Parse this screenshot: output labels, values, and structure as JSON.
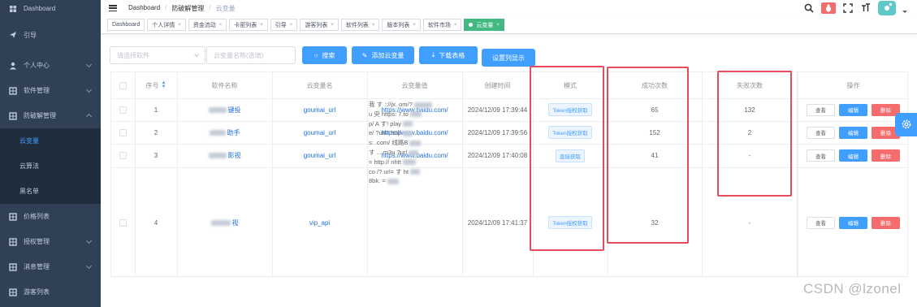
{
  "sidebar": {
    "items": [
      {
        "label": "Dashboard"
      },
      {
        "label": "引导"
      },
      {
        "label": "个人中心"
      },
      {
        "label": "软件管理"
      },
      {
        "label": "防破解管理"
      },
      {
        "label": "价格列表"
      },
      {
        "label": "授权管理"
      },
      {
        "label": "消息管理"
      },
      {
        "label": "游客列表"
      }
    ],
    "subitems": [
      {
        "label": "云变量"
      },
      {
        "label": "云算法"
      },
      {
        "label": "黑名单"
      }
    ]
  },
  "breadcrumb": {
    "items": [
      "Dashboard",
      "防破解管理",
      "云变量"
    ]
  },
  "tags": [
    {
      "label": "Dashboard"
    },
    {
      "label": "个人详情"
    },
    {
      "label": "资金流动"
    },
    {
      "label": "卡密列表"
    },
    {
      "label": "引导"
    },
    {
      "label": "游客列表"
    },
    {
      "label": "软件列表"
    },
    {
      "label": "版本列表"
    },
    {
      "label": "软件市场"
    },
    {
      "label": "云变量"
    }
  ],
  "toolbar": {
    "software_placeholder": "请选择软件",
    "name_placeholder": "云变量名称(选填)",
    "search_label": "搜索",
    "add_label": "添加云变量",
    "download_label": "下载表格",
    "columns_label": "设置列显示"
  },
  "table": {
    "headers": [
      "序号",
      "软件名称",
      "云变量名",
      "云变量值",
      "创建时间",
      "模式",
      "成功次数",
      "失败次数",
      "操作"
    ],
    "rows": [
      {
        "index": "1",
        "software": "键投",
        "name": "goumai_url",
        "value": "https://www.baidu.com/",
        "time": "2024/12/09 17:39:44",
        "mode": "Token授权获取",
        "success": "65",
        "fail": "132"
      },
      {
        "index": "2",
        "software": "助手",
        "name": "goumai_url",
        "value": "https://www.baidu.com/",
        "time": "2024/12/09 17:39:56",
        "mode": "Token授权获取",
        "success": "152",
        "fail": "2"
      },
      {
        "index": "3",
        "software": "影视",
        "name": "goumai_url",
        "value": "https://www.baidu.com/",
        "time": "2024/12/09 17:40:08",
        "mode": "直接获取",
        "success": "41",
        "fail": "-"
      },
      {
        "index": "4",
        "software": "视",
        "name": "vip_api",
        "value_lines": [
          "我 す :://jx. om/?",
          "u 央 https: 7.to",
          "p/ A す! play",
          "e/ ?url= http",
          "s: .com/ 线路B",
          "す ... m3u ?url",
          "= http:// nhtt",
          "co /? url= す ht",
          "8bk. ="
        ],
        "time": "2024/12/09 17:41:37",
        "mode": "Token授权获取",
        "success": "32",
        "fail": "-"
      }
    ],
    "actions": {
      "view": "查看",
      "edit": "编辑",
      "delete": "删除"
    }
  },
  "watermark": "CSDN @lzonel",
  "colors": {
    "sidebar": "#304156",
    "primary": "#409eff",
    "danger": "#f56c6c",
    "success_tag": "#42b983",
    "highlight_box": "#e74c5b"
  }
}
